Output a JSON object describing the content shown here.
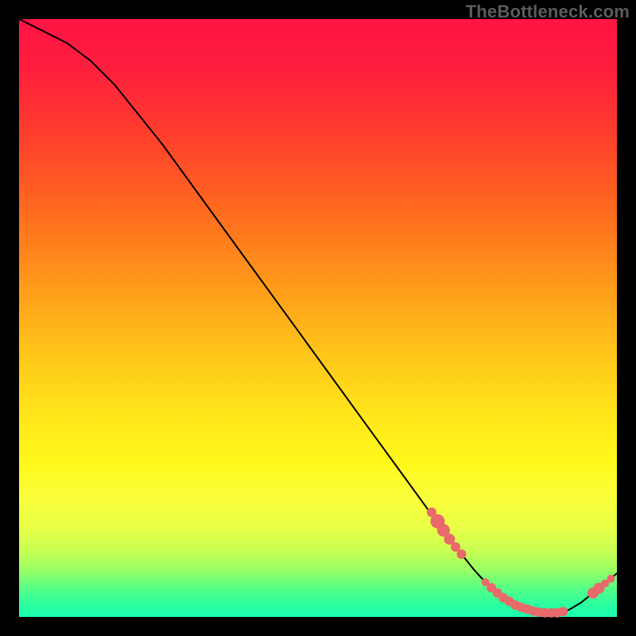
{
  "watermark": "TheBottleneck.com",
  "chart_data": {
    "type": "line",
    "title": "",
    "xlabel": "",
    "ylabel": "",
    "xlim": [
      0,
      100
    ],
    "ylim": [
      0,
      100
    ],
    "series": [
      {
        "name": "bottleneck-curve",
        "x": [
          0,
          4,
          8,
          12,
          16,
          20,
          24,
          28,
          32,
          36,
          40,
          44,
          48,
          52,
          56,
          60,
          64,
          68,
          72,
          74,
          76,
          78,
          80,
          82,
          84,
          86,
          88,
          90,
          92,
          94,
          96,
          98,
          100
        ],
        "y": [
          100,
          98,
          96,
          93,
          89,
          84,
          79,
          73.5,
          68,
          62.5,
          57,
          51.5,
          46,
          40.5,
          35,
          29.5,
          24,
          18.5,
          13,
          10.5,
          8,
          5.8,
          4,
          2.6,
          1.6,
          1,
          0.7,
          0.7,
          1.2,
          2.4,
          4,
          5.6,
          7.3
        ]
      }
    ],
    "markers": {
      "name": "highlight-points",
      "color": "#e86a6a",
      "points": [
        {
          "x": 69,
          "y": 17.5,
          "r": 6
        },
        {
          "x": 70,
          "y": 16,
          "r": 9
        },
        {
          "x": 71,
          "y": 14.5,
          "r": 8
        },
        {
          "x": 72,
          "y": 13,
          "r": 7
        },
        {
          "x": 73,
          "y": 11.7,
          "r": 6
        },
        {
          "x": 74,
          "y": 10.5,
          "r": 6
        },
        {
          "x": 78,
          "y": 5.8,
          "r": 5
        },
        {
          "x": 79,
          "y": 4.9,
          "r": 6
        },
        {
          "x": 80,
          "y": 4.0,
          "r": 6
        },
        {
          "x": 81,
          "y": 3.2,
          "r": 6
        },
        {
          "x": 82,
          "y": 2.6,
          "r": 6
        },
        {
          "x": 83,
          "y": 2.0,
          "r": 6
        },
        {
          "x": 84,
          "y": 1.6,
          "r": 6
        },
        {
          "x": 85,
          "y": 1.3,
          "r": 6
        },
        {
          "x": 86,
          "y": 1.0,
          "r": 6
        },
        {
          "x": 87,
          "y": 0.8,
          "r": 6
        },
        {
          "x": 88,
          "y": 0.7,
          "r": 6
        },
        {
          "x": 89,
          "y": 0.7,
          "r": 6
        },
        {
          "x": 90,
          "y": 0.7,
          "r": 6
        },
        {
          "x": 91,
          "y": 0.9,
          "r": 6
        },
        {
          "x": 96,
          "y": 4.0,
          "r": 7
        },
        {
          "x": 97,
          "y": 4.8,
          "r": 7
        },
        {
          "x": 98,
          "y": 5.6,
          "r": 5
        },
        {
          "x": 99,
          "y": 6.4,
          "r": 5
        }
      ]
    },
    "grid": false,
    "legend": false
  }
}
